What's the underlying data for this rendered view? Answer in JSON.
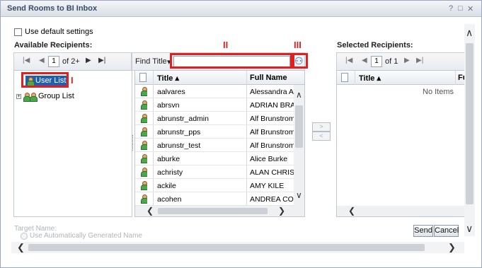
{
  "dialog": {
    "title": "Send Rooms to BI Inbox",
    "title_buttons": [
      "?",
      "□",
      "✕"
    ]
  },
  "settings": {
    "use_default_label": "Use default settings",
    "use_default_checked": false
  },
  "available": {
    "heading": "Available Recipients:",
    "pager": {
      "page": "1",
      "of": "of 2+"
    },
    "find_label": "Find Title",
    "find_arrow": "▾",
    "search_value": "",
    "tree": {
      "user_list": "User List",
      "group_list": "Group List",
      "expander": "+"
    },
    "columns": {
      "title": "Title ▴",
      "full_name": "Full Name"
    },
    "rows": [
      {
        "title": "aalvares",
        "full_name": "Alessandra Alva"
      },
      {
        "title": "abrsvn",
        "full_name": "ADRIAN BRASC"
      },
      {
        "title": "abrunstr_admin",
        "full_name": "Alf Brunstrom"
      },
      {
        "title": "abrunstr_pps",
        "full_name": "Alf Brunstrom"
      },
      {
        "title": "abrunstr_test",
        "full_name": "Alf Brunstrom -"
      },
      {
        "title": "aburke",
        "full_name": "Alice Burke"
      },
      {
        "title": "achristy",
        "full_name": "ALAN CHRISTY"
      },
      {
        "title": "ackile",
        "full_name": "AMY KILE"
      },
      {
        "title": "acohen",
        "full_name": "ANDREA COHEN"
      }
    ]
  },
  "annotations": {
    "one": "I",
    "two": "II",
    "three": "III"
  },
  "move": {
    "add": ">",
    "remove": "<"
  },
  "selected": {
    "heading": "Selected Recipients:",
    "pager": {
      "page": "1",
      "of": "of 1"
    },
    "columns": {
      "title": "Title ▴",
      "full_name": "Fu"
    },
    "empty_text": "No Items"
  },
  "footer": {
    "target_name_label": "Target Name:",
    "auto_name_label": "Use Automatically Generated Name",
    "send_label": "Send",
    "cancel_label": "Cancel"
  },
  "icons": {
    "first": "|◀",
    "prev": "◀",
    "next": "▶",
    "last": "▶|",
    "scroll_up": "∧",
    "scroll_down": "∨",
    "scroll_left": "❮",
    "scroll_right": "❯",
    "binoculars": "⚇"
  },
  "colors": {
    "annotation_red": "#e02020",
    "selection_blue": "#1f5fb3"
  }
}
